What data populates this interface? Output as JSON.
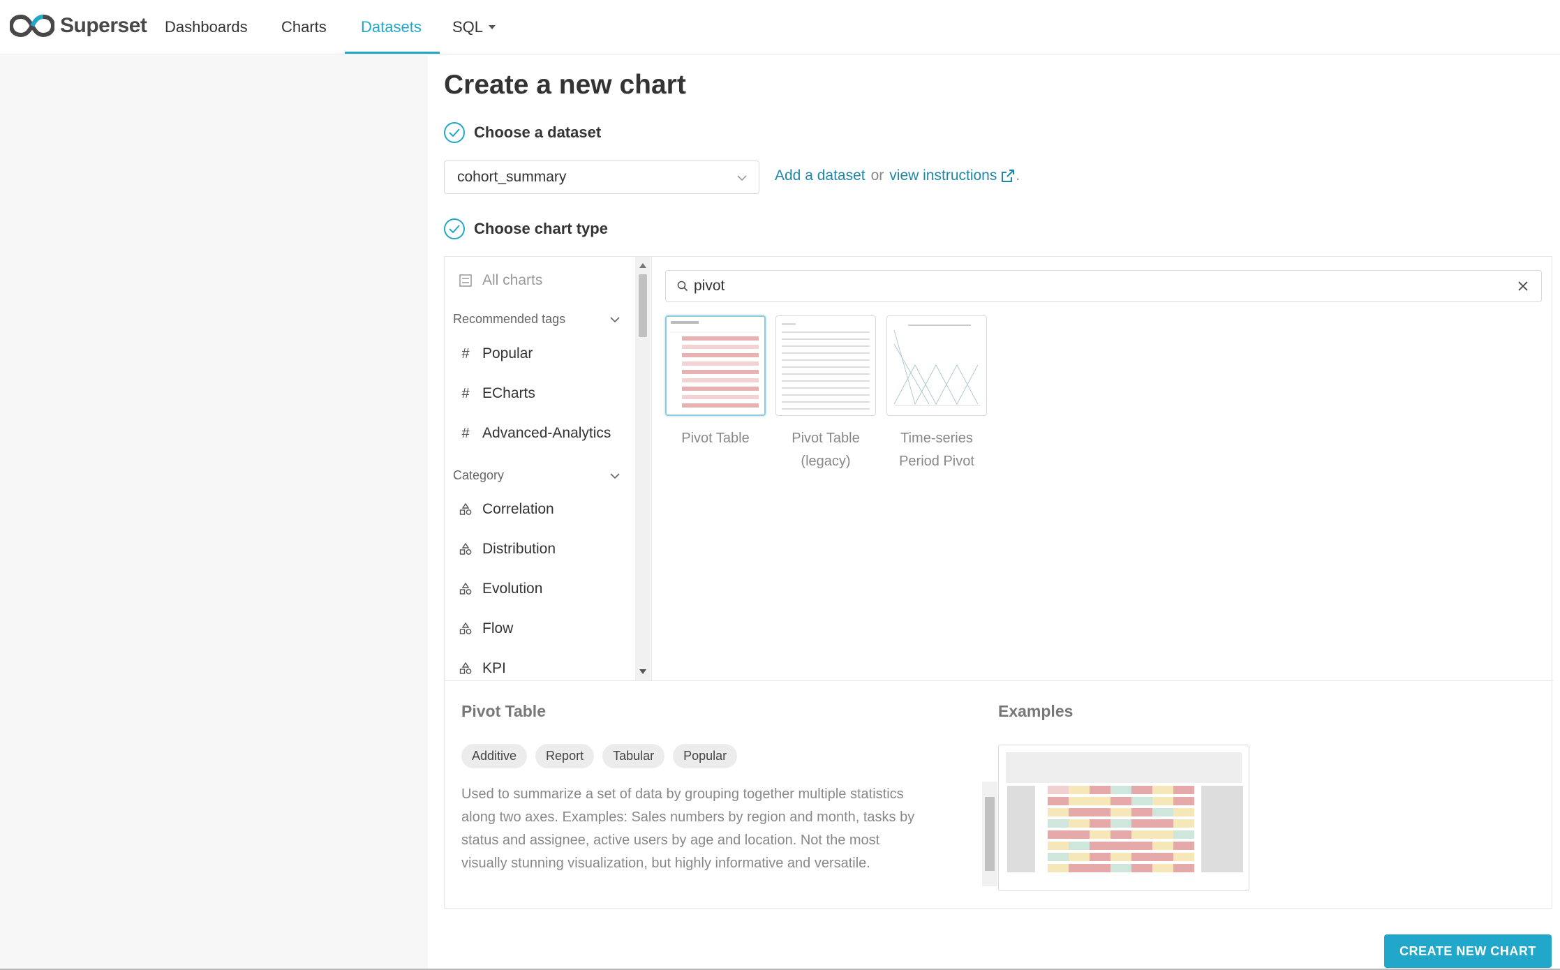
{
  "navbar": {
    "brand": "Superset",
    "items": [
      {
        "label": "Dashboards"
      },
      {
        "label": "Charts"
      },
      {
        "label": "Datasets",
        "active": true
      },
      {
        "label": "SQL"
      }
    ]
  },
  "page": {
    "title": "Create a new chart",
    "step1_label": "Choose a dataset",
    "step2_label": "Choose chart type",
    "dataset_value": "cohort_summary",
    "add_dataset_link": "Add a dataset",
    "or_text": "or",
    "view_instructions_link": "view instructions",
    "period": "."
  },
  "sidebar": {
    "all_charts": "All charts",
    "recommended_header": "Recommended tags",
    "tags": [
      "Popular",
      "ECharts",
      "Advanced-Analytics"
    ],
    "category_header": "Category",
    "categories": [
      "Correlation",
      "Distribution",
      "Evolution",
      "Flow",
      "KPI"
    ]
  },
  "search": {
    "value": "pivot"
  },
  "results": [
    {
      "label": "Pivot Table",
      "selected": true
    },
    {
      "label": "Pivot Table (legacy)"
    },
    {
      "label": "Time-series Period Pivot"
    }
  ],
  "detail": {
    "title": "Pivot Table",
    "tags": [
      "Additive",
      "Report",
      "Tabular",
      "Popular"
    ],
    "description": "Used to summarize a set of data by grouping together multiple statistics along two axes. Examples: Sales numbers by region and month, tasks by status and assignee, active users by age and location. Not the most visually stunning visualization, but highly informative and versatile.",
    "examples_title": "Examples"
  },
  "actions": {
    "create_label": "CREATE NEW CHART"
  },
  "colors": {
    "accent": "#20a7c9",
    "link": "#1f87a8"
  }
}
